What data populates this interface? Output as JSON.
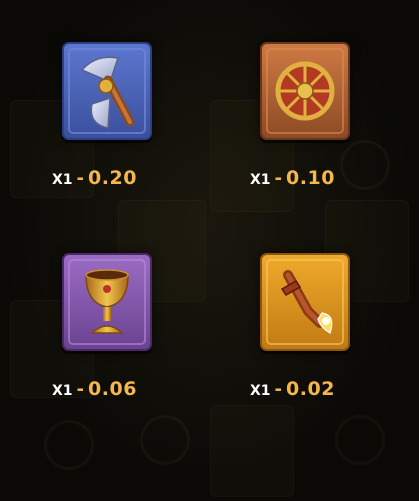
{
  "paytable": [
    {
      "symbol": "axe-icon",
      "multiplier": "X1",
      "separator": "-",
      "value": "0.20",
      "colors": {
        "tile": "#4a63b8",
        "border": "#2e3f86"
      }
    },
    {
      "symbol": "shield-icon",
      "multiplier": "X1",
      "separator": "-",
      "value": "0.10",
      "colors": {
        "tile": "#b8683a",
        "border": "#7a4020"
      }
    },
    {
      "symbol": "chalice-icon",
      "multiplier": "X1",
      "separator": "-",
      "value": "0.06",
      "colors": {
        "tile": "#8a5ab0",
        "border": "#5a3478"
      }
    },
    {
      "symbol": "torch-horn-icon",
      "multiplier": "X1",
      "separator": "-",
      "value": "0.02",
      "colors": {
        "tile": "#e09a22",
        "border": "#9a6210"
      }
    }
  ],
  "colors": {
    "value_text": "#f3b74c",
    "multiplier_text": "#ffffff",
    "background": "#0a0906"
  }
}
